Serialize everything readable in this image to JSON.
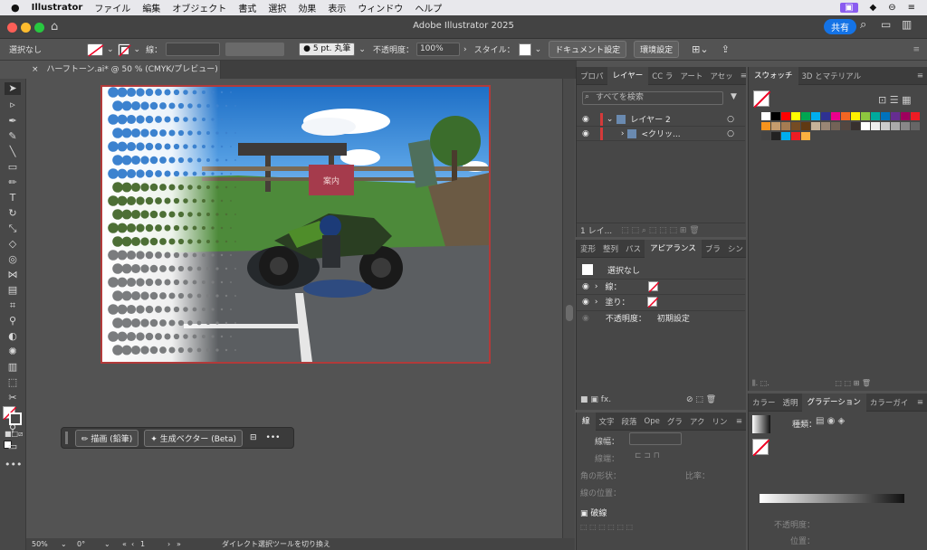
{
  "menubar": {
    "app": "Illustrator",
    "items": [
      "ファイル",
      "編集",
      "オブジェクト",
      "書式",
      "選択",
      "効果",
      "表示",
      "ウィンドウ",
      "ヘルプ"
    ]
  },
  "window": {
    "title": "Adobe Illustrator 2025",
    "share": "共有"
  },
  "control": {
    "selection": "選択なし",
    "stroke_label": "線：",
    "brush": "5 pt. 丸筆",
    "opacity_label": "不透明度：",
    "opacity": "100%",
    "style_label": "スタイル：",
    "doc_setup": "ドキュメント設定",
    "prefs": "環境設定"
  },
  "doc": {
    "tab": "ハーフトーン.ai* @ 50 % (CMYK/プレビュー)"
  },
  "photo": {
    "sign": "案内"
  },
  "context": {
    "draw": "描画 (鉛筆)",
    "gen": "生成ベクター (Beta)",
    "more": "•••"
  },
  "status": {
    "zoom": "50%",
    "angle": "0°",
    "artboard": "1",
    "msg": "ダイレクト選択ツールを切り換え"
  },
  "layers": {
    "tabs": [
      "プロパ",
      "レイヤー",
      "CC ラ",
      "アート",
      "アセッ"
    ],
    "search": "すべてを検索",
    "items": [
      "レイヤー 2",
      "<クリッ..."
    ],
    "footer": "1 レイ..."
  },
  "appearance": {
    "tabs": [
      "変形",
      "整列",
      "パス",
      "アピアランス",
      "ブラ",
      "シン"
    ],
    "title": "選択なし",
    "stroke": "線：",
    "fill": "塗り：",
    "opacity": "不透明度：",
    "opacity_val": "初期設定"
  },
  "stroke": {
    "tabs": [
      "線",
      "文字",
      "段落",
      "Ope",
      "グラ",
      "アク",
      "リン"
    ],
    "width": "線幅：",
    "cap": "線端：",
    "corner": "角の形状：",
    "ratio": "比率：",
    "align": "線の位置：",
    "dash": "破線"
  },
  "swatches": {
    "tabs": [
      "スウォッチ",
      "3D とマテリアル"
    ]
  },
  "gradient": {
    "tabs": [
      "カラー",
      "透明",
      "グラデーション",
      "カラーガイ"
    ],
    "type": "種類：",
    "opacity": "不透明度：",
    "location": "位置："
  }
}
